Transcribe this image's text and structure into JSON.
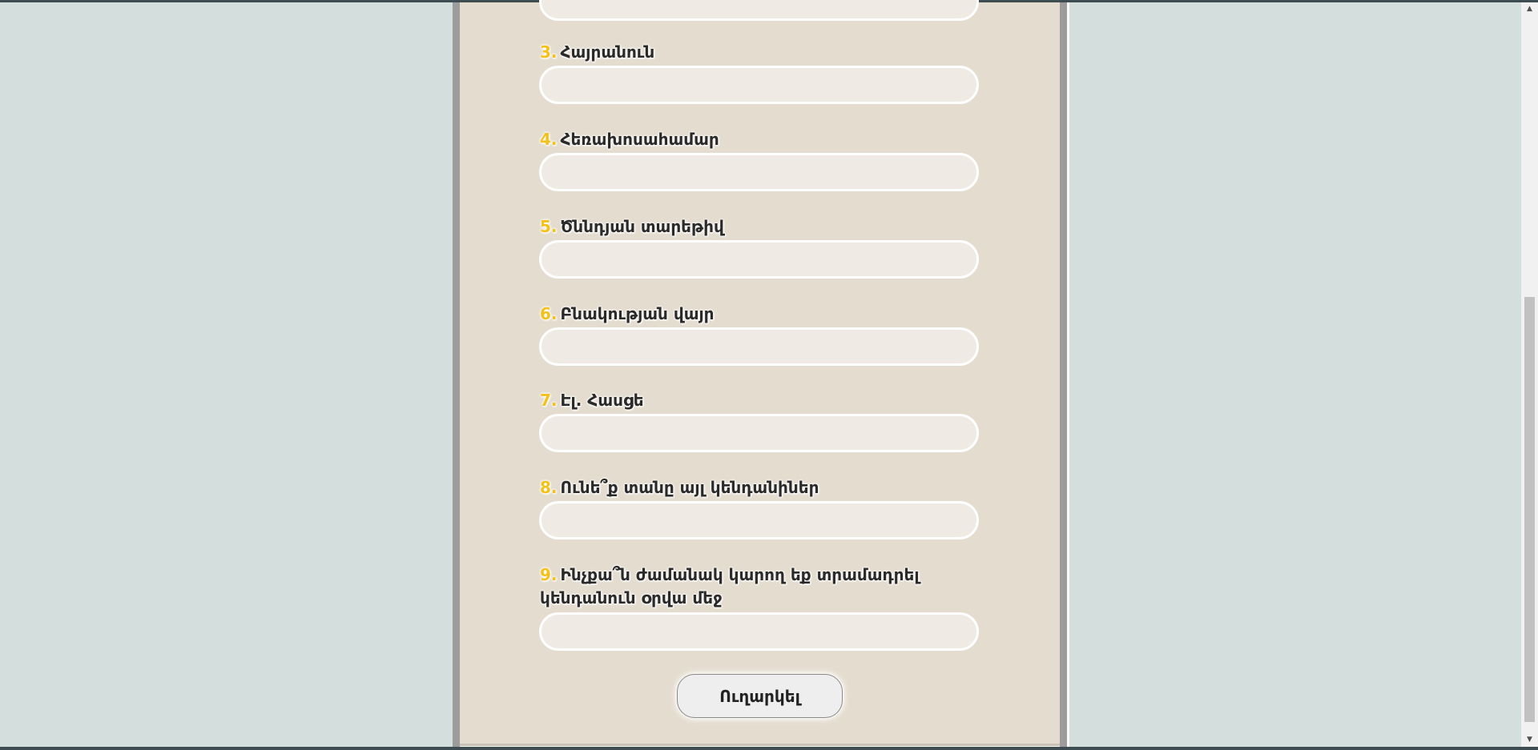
{
  "form": {
    "fields": [
      {
        "number": "3.",
        "label": "Հայրանուն",
        "value": ""
      },
      {
        "number": "4.",
        "label": "Հեռախոսահամար",
        "value": ""
      },
      {
        "number": "5.",
        "label": "Ծննդյան տարեթիվ",
        "value": ""
      },
      {
        "number": "6.",
        "label": "Բնակության վայր",
        "value": ""
      },
      {
        "number": "7.",
        "label": "Էլ. Հասցե",
        "value": ""
      },
      {
        "number": "8.",
        "label": "Ունե՞ք տանը այլ կենդանիներ",
        "value": ""
      },
      {
        "number": "9.",
        "label": "Ինչքա՞ն ժամանակ կարող եք տրամադրել կենդանուն օրվա մեջ",
        "value": ""
      }
    ],
    "submit_label": "Ուղարկել"
  },
  "scrollbar": {
    "up_icon": "triangle-up",
    "down_icon": "triangle-down"
  },
  "colors": {
    "page_background": "#d4dedd",
    "panel_background": "#e4dccf",
    "number_accent": "#f2c21b",
    "input_background": "#efebe4"
  }
}
